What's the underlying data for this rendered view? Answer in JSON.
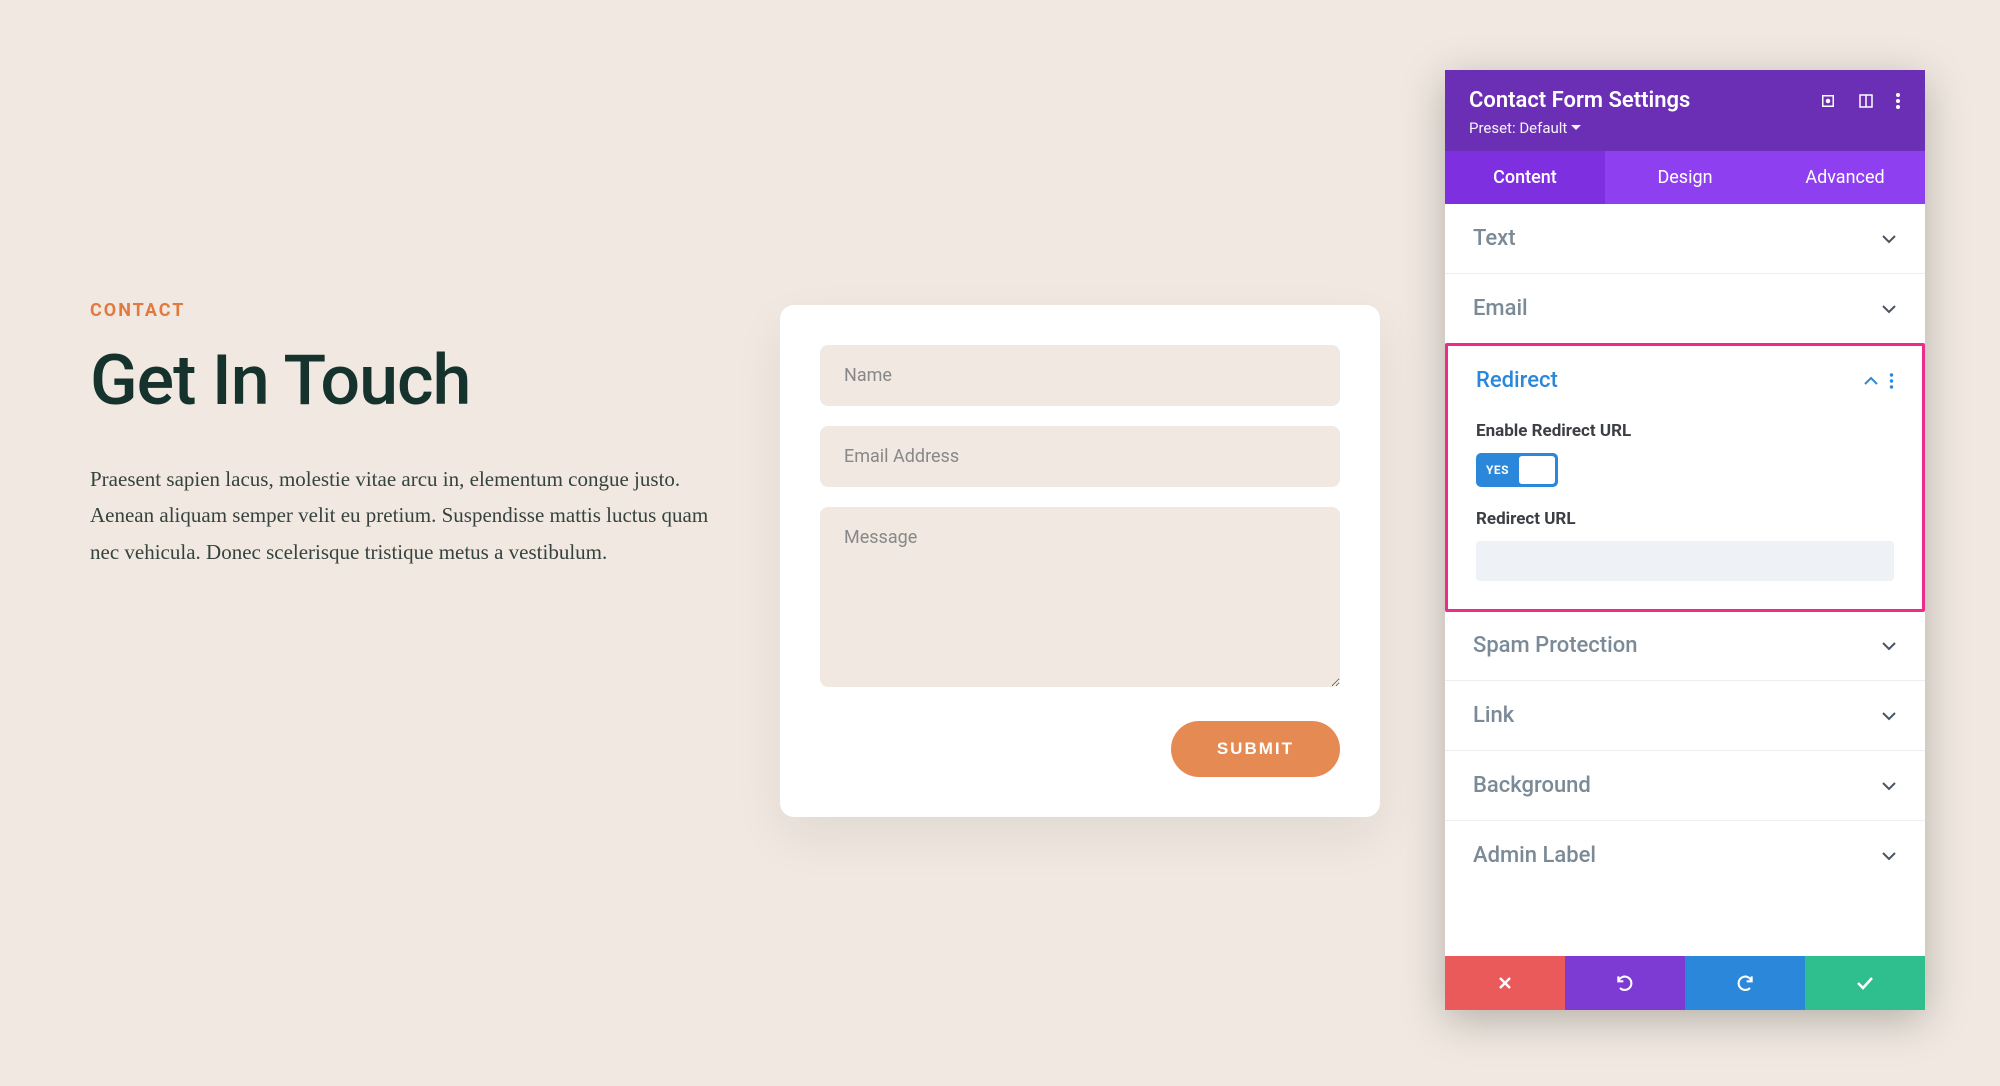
{
  "page": {
    "eyebrow": "CONTACT",
    "headline": "Get In Touch",
    "body": "Praesent sapien lacus, molestie vitae arcu in, elementum congue justo. Aenean aliquam semper velit eu pretium. Suspendisse mattis luctus quam nec vehicula. Donec scelerisque tristique metus a vestibulum."
  },
  "form": {
    "name_placeholder": "Name",
    "email_placeholder": "Email Address",
    "message_placeholder": "Message",
    "submit_label": "SUBMIT"
  },
  "panel": {
    "title": "Contact Form Settings",
    "preset_label": "Preset: Default",
    "tabs": {
      "content": "Content",
      "design": "Design",
      "advanced": "Advanced"
    },
    "sections": {
      "text": "Text",
      "email": "Email",
      "redirect": "Redirect",
      "spam": "Spam Protection",
      "link": "Link",
      "background": "Background",
      "admin_label": "Admin Label"
    },
    "redirect": {
      "enable_label": "Enable Redirect URL",
      "toggle_value": "YES",
      "url_label": "Redirect URL",
      "url_value": ""
    }
  }
}
